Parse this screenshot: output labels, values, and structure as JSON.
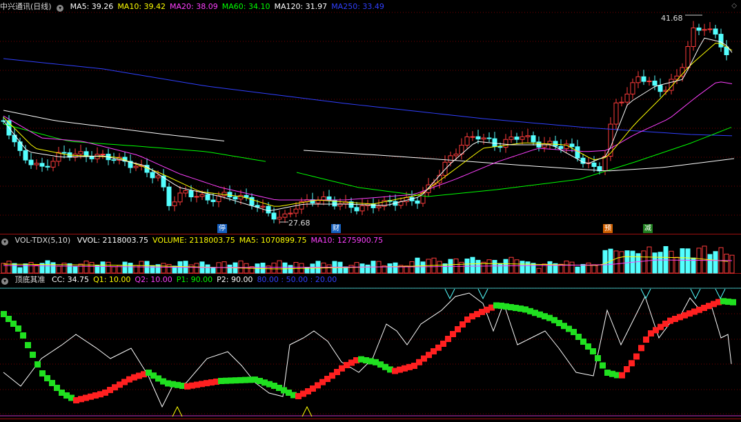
{
  "main": {
    "stock_title": "中兴通讯(日线)",
    "ma_labels": [
      {
        "text": "MA5: 39.26",
        "color": "#ffffff"
      },
      {
        "text": "MA10: 39.42",
        "color": "#ffff00"
      },
      {
        "text": "MA20: 38.09",
        "color": "#ff40ff"
      },
      {
        "text": "MA60: 34.10",
        "color": "#00ff00"
      },
      {
        "text": "MA120: 31.97",
        "color": "#ffffff"
      },
      {
        "text": "MA250: 33.49",
        "color": "#3040ff"
      }
    ],
    "high_label": "41.68",
    "low_label": "27.68",
    "event_tags": [
      {
        "text": "停",
        "color": "#1560c0"
      },
      {
        "text": "财",
        "color": "#1560c0"
      },
      {
        "text": "预",
        "color": "#d06000"
      },
      {
        "text": "减",
        "color": "#208020"
      }
    ]
  },
  "volume": {
    "title": "VOL-TDX(5,10)",
    "labels": [
      {
        "text": "VVOL: 2118003.75",
        "color": "#ffffff"
      },
      {
        "text": "VOLUME: 2118003.75",
        "color": "#ffff00"
      },
      {
        "text": "MA5: 1070899.75",
        "color": "#ffff00"
      },
      {
        "text": "MA10: 1275900.75",
        "color": "#ff40ff"
      }
    ]
  },
  "indicator": {
    "title": "顶底其准",
    "labels": [
      {
        "text": "CC: 34.75",
        "color": "#ffffff"
      },
      {
        "text": "Q1: 10.00",
        "color": "#ffff00"
      },
      {
        "text": "Q2: 10.00",
        "color": "#ff40ff"
      },
      {
        "text": "P1: 90.00",
        "color": "#00ff00"
      },
      {
        "text": "P2: 90.00",
        "color": "#ffffff"
      },
      {
        "text": "80.00 : 50.00 : 20.00",
        "color": "#3040ff"
      }
    ]
  },
  "colors": {
    "up": "#ff3b3b",
    "down": "#54ffff",
    "grid": "#800000"
  }
}
